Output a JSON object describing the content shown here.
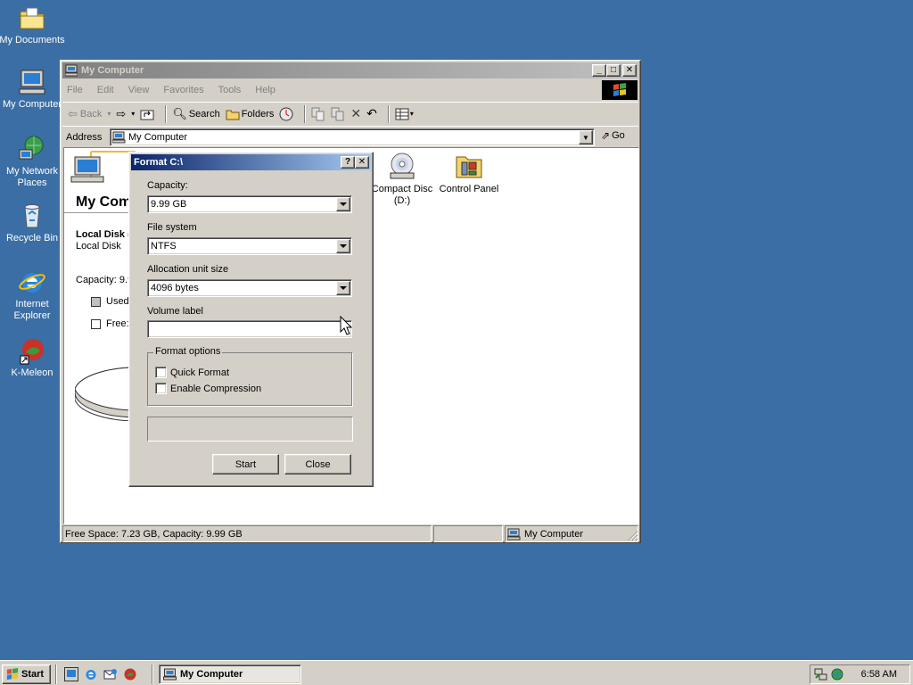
{
  "desktop": {
    "icons": [
      {
        "label": "My Documents"
      },
      {
        "label": "My Computer"
      },
      {
        "label": "My Network Places"
      },
      {
        "label": "Recycle Bin"
      },
      {
        "label": "Internet Explorer"
      },
      {
        "label": "K-Meleon"
      }
    ]
  },
  "window": {
    "title": "My Computer",
    "menu": [
      "File",
      "Edit",
      "View",
      "Favorites",
      "Tools",
      "Help"
    ],
    "toolbar": {
      "back": "Back",
      "search": "Search",
      "folders": "Folders"
    },
    "address": {
      "label": "Address",
      "value": "My Computer",
      "go": "Go"
    },
    "panel": {
      "heading": "My Computer",
      "drive_title": "Local Disk (",
      "drive_type": "Local Disk",
      "capacity": "Capacity: 9.9",
      "used": "Used:",
      "free": "Free:"
    },
    "items": [
      {
        "label": "Compact Disc (D:)"
      },
      {
        "label": "Control Panel"
      }
    ],
    "status": {
      "info": "Free Space: 7.23 GB, Capacity: 9.99 GB",
      "zone": "My Computer"
    }
  },
  "dialog": {
    "title": "Format C:\\",
    "capacity_label": "Capacity:",
    "capacity_value": "9.99 GB",
    "filesystem_label": "File system",
    "filesystem_value": "NTFS",
    "alloc_label": "Allocation unit size",
    "alloc_value": "4096 bytes",
    "volume_label": "Volume label",
    "volume_value": "",
    "options_legend": "Format options",
    "quick_format": "Quick Format",
    "quick_format_checked": false,
    "compression": "Enable Compression",
    "compression_checked": false,
    "progress": 0,
    "start": "Start",
    "close": "Close"
  },
  "taskbar": {
    "start": "Start",
    "task": "My Computer",
    "clock": "6:58 AM"
  },
  "colors": {
    "desktop": "#3a6ea5",
    "face": "#d4d0c8",
    "title_active": "#0a246a",
    "title_inactive": "#808080"
  }
}
